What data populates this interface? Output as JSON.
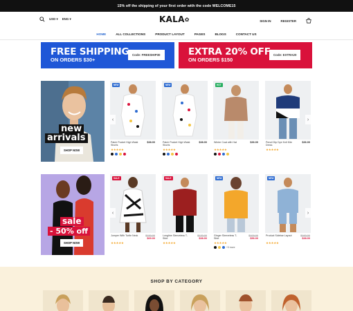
{
  "topbar": {
    "text": "15% off the shipping of your first order with the code WELCOME15"
  },
  "header": {
    "currency": "USD",
    "language": "ENG",
    "logo": "KALA",
    "sign_in": "SIGN IN",
    "register": "REGISTER"
  },
  "nav": [
    "HOME",
    "ALL COLLECTIONS",
    "PRODUCT LAYOUT",
    "PAGES",
    "BLOGS",
    "CONTACT US"
  ],
  "promos": [
    {
      "title": "FREE SHIPPING",
      "subtitle": "ON ORDERS $30+",
      "code": "Code: FREESHIP30",
      "color": "#1f57d7"
    },
    {
      "title": "EXTRA 20% OFF",
      "subtitle": "ON ORDERS $150",
      "code": "Code: EXTRA20",
      "color": "#d9123b"
    }
  ],
  "banners": [
    {
      "line1": "new",
      "line2": "arrivals",
      "button": "SHOP NOW"
    },
    {
      "line1": "sale",
      "line2": "- 50% off",
      "button": "SHOP NOW"
    }
  ],
  "row1": [
    {
      "badge": "NEW",
      "name": "Patch Pocket High Waist Shorts",
      "price": "$38.00",
      "stars": "★★★★★",
      "swatches": [
        "#111111",
        "#2d6bd1",
        "#f3c542",
        "#d9123b"
      ]
    },
    {
      "badge": "NEW",
      "name": "Patch Pocket High Waist Shorts",
      "price": "$38.00",
      "stars": "★★★★★",
      "swatches": [
        "#111111",
        "#2d6bd1",
        "#f3c542",
        "#d9123b"
      ]
    },
    {
      "badge": "HOT",
      "name": "Winter Coat with Hat",
      "price": "$36.00",
      "stars": "★★★★★",
      "swatches": [
        "#111111",
        "#d9123b",
        "#2d6bd1",
        "#f3c542"
      ]
    },
    {
      "badge": "",
      "name": "Pencil Dip Dye Knit Kite Dress",
      "price": "$36.00",
      "stars": "★★★★★",
      "swatches": []
    }
  ],
  "row2": [
    {
      "badge": "SALE",
      "name": "Jumper With Turtle Neck",
      "old": "$150.00",
      "price": "$69.00",
      "stars": "★★★★★",
      "swatches": []
    },
    {
      "badge": "SALE",
      "name": "Longline Sleeveless T-Shirt",
      "old": "$120.00",
      "price": "$38.00",
      "stars": "★★★★★",
      "swatches": []
    },
    {
      "badge": "NEW",
      "name": "Ginger Sleeveless T-Shirt",
      "old": "$100.00",
      "price": "$56.00",
      "stars": "★★★★★",
      "swatches": [
        "#111111",
        "#f3c542",
        "#2d6bd1"
      ],
      "extra": "+3 more"
    },
    {
      "badge": "NEW",
      "name": "Product Sidebar Layout",
      "old": "$160.00",
      "price": "$38.00",
      "stars": "★★★★★",
      "swatches": []
    }
  ],
  "category": {
    "title": "SHOP BY CATEGORY"
  }
}
